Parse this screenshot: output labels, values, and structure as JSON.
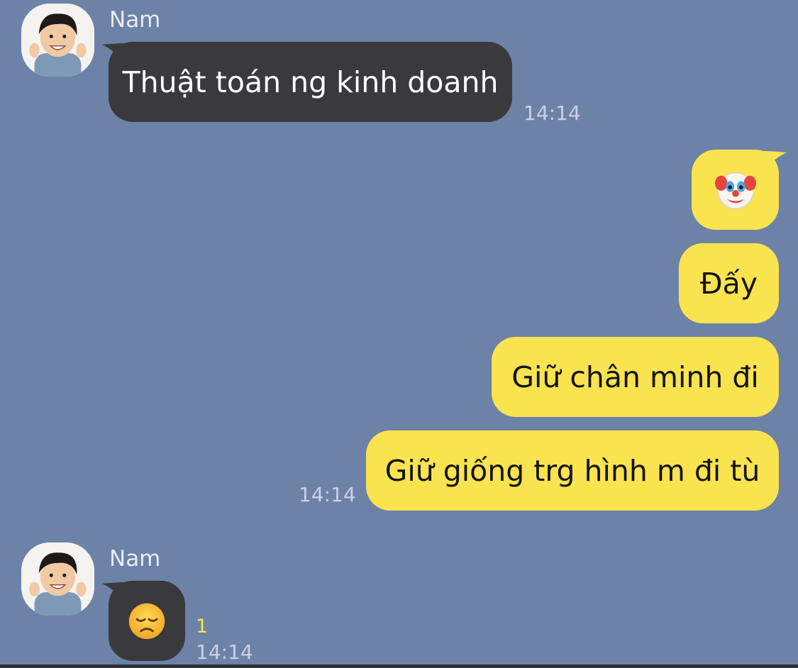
{
  "messages": [
    {
      "sender": "Nam",
      "text": "Thuật toán ng kinh doanh",
      "time": "14:14"
    },
    {
      "outgoing": [
        "🤡",
        "Đấy",
        "Giữ chân minh đi",
        "Giữ giống trg hình m đi tù"
      ],
      "time": "14:14"
    },
    {
      "sender": "Nam",
      "text": "😞",
      "time": "14:14",
      "unread_count": "1"
    }
  ],
  "icons": {
    "avatar": "avatar-photo",
    "clown": "clown-face-emoji",
    "sad": "disappointed-face-emoji"
  },
  "colors": {
    "background": "#6d82a7",
    "incoming_bubble": "#3a3a3d",
    "outgoing_bubble": "#f9e34f",
    "unread": "#f6e84a"
  }
}
